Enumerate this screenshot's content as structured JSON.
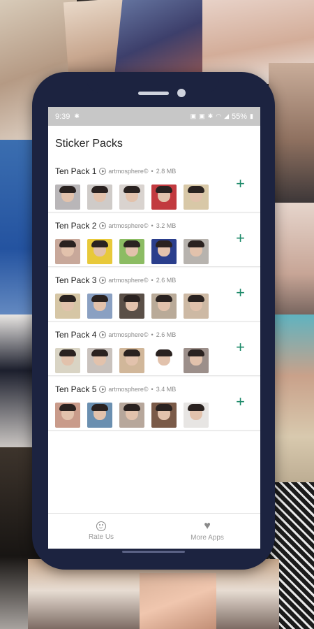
{
  "statusbar": {
    "time": "9:39",
    "battery": "55%"
  },
  "header": {
    "title": "Sticker Packs"
  },
  "packs": [
    {
      "name": "Ten Pack 1",
      "author": "artmosphere©",
      "size": "2.8 MB",
      "thumbs": [
        "#b9b6b8",
        "#cfcbc8",
        "#d9d3cf",
        "#c23a3f",
        "#d8c8a7"
      ]
    },
    {
      "name": "Ten Pack 2",
      "author": "artmosphere©",
      "size": "3.2 MB",
      "thumbs": [
        "#c8a89a",
        "#e8c93a",
        "#8cbc63",
        "#2a3e8c",
        "#b7b3ae"
      ]
    },
    {
      "name": "Ten Pack 3",
      "author": "artmosphere©",
      "size": "2.6 MB",
      "thumbs": [
        "#d6c6a5",
        "#8aa0c2",
        "#5a4f47",
        "#b9aa98",
        "#cdb9a4"
      ]
    },
    {
      "name": "Ten Pack 4",
      "author": "artmosphere©",
      "size": "2.6 MB",
      "thumbs": [
        "#d9d4c4",
        "#c9c2bd",
        "#d1b79a",
        "#ffffff",
        "#9c8f8a"
      ]
    },
    {
      "name": "Ten Pack 5",
      "author": "artmosphere©",
      "size": "3.4 MB",
      "thumbs": [
        "#c99b8a",
        "#6a8fb0",
        "#b7a79b",
        "#7a5a48",
        "#e7e5e3"
      ]
    }
  ],
  "bottom_nav": {
    "rate": "Rate Us",
    "more": "More Apps"
  },
  "colors": {
    "accent": "#1e8a6a",
    "frame": "#1c2340"
  }
}
